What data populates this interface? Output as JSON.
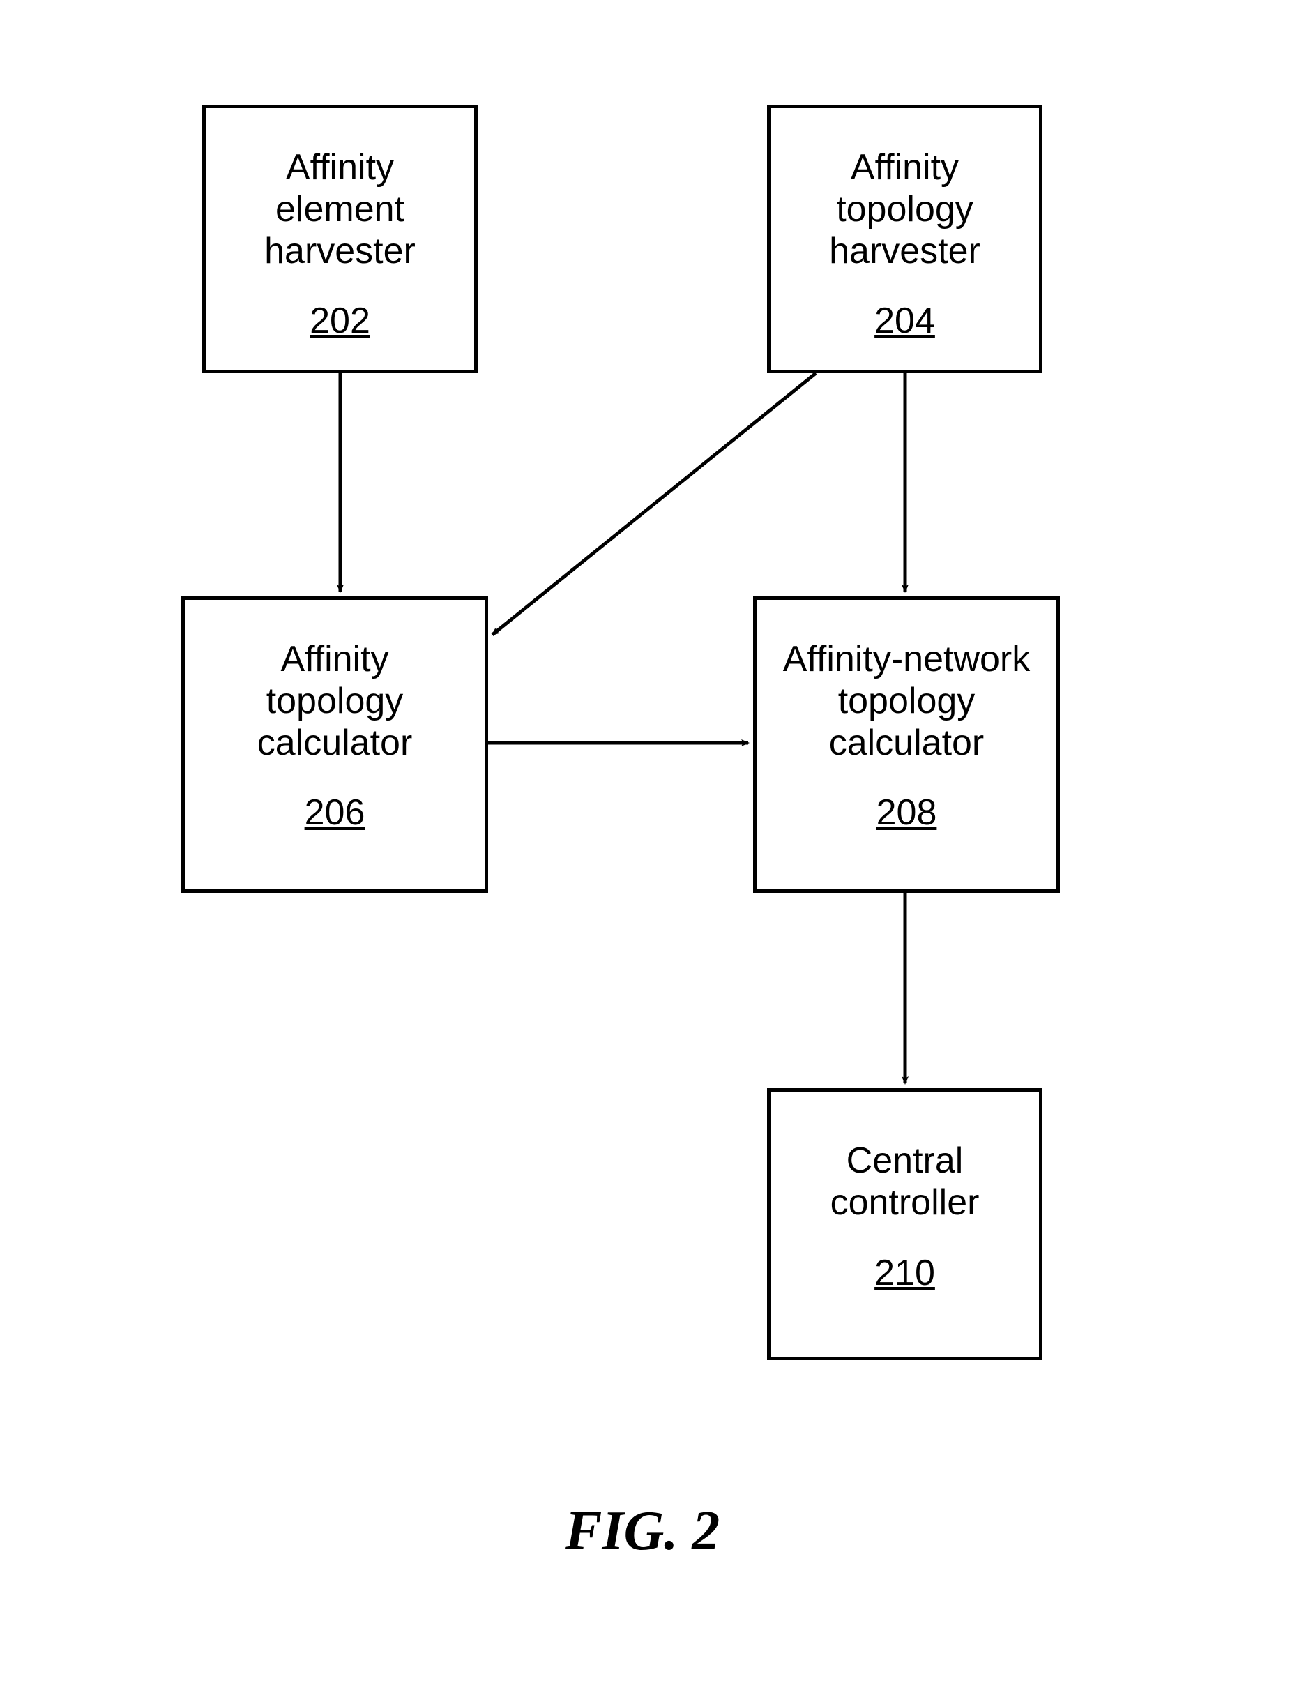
{
  "boxes": {
    "box_202": {
      "label": "Affinity\nelement\nharvester",
      "num": "202"
    },
    "box_204": {
      "label": "Affinity\ntopology\nharvester",
      "num": "204"
    },
    "box_206": {
      "label": "Affinity\ntopology\ncalculator",
      "num": "206"
    },
    "box_208": {
      "label": "Affinity-network\ntopology\ncalculator",
      "num": "208"
    },
    "box_210": {
      "label": "Central\ncontroller",
      "num": "210"
    }
  },
  "caption": "FIG. 2"
}
